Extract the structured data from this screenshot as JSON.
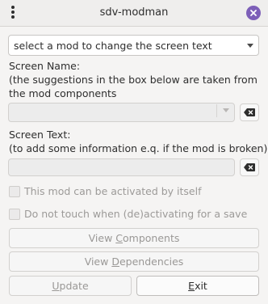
{
  "window": {
    "title": "sdv-modman",
    "menu_icon": "vertical-dots-icon",
    "close_icon": "close-icon",
    "accent": "#7d5fb8"
  },
  "mod_selector": {
    "value": "select a mod to change the screen text"
  },
  "screen_name": {
    "label_line1": "Screen Name:",
    "label_line2": "(the suggestions in the box below are taken from",
    "label_line3": "the mod components",
    "value": ""
  },
  "screen_text": {
    "label_line1": "Screen Text:",
    "label_line2": "(to add some information e.q. if the mod is broken)",
    "value": ""
  },
  "options": {
    "activate_alone": "This mod can be activated by itself",
    "dont_touch": "Do not touch when (de)activating for a save"
  },
  "buttons": {
    "view_components_pre": "View ",
    "view_components_mnemonic": "C",
    "view_components_post": "omponents",
    "view_dependencies_pre": "View ",
    "view_dependencies_mnemonic": "D",
    "view_dependencies_post": "ependencies",
    "update_mnemonic": "U",
    "update_post": "pdate",
    "exit_mnemonic": "E",
    "exit_post": "xit"
  }
}
